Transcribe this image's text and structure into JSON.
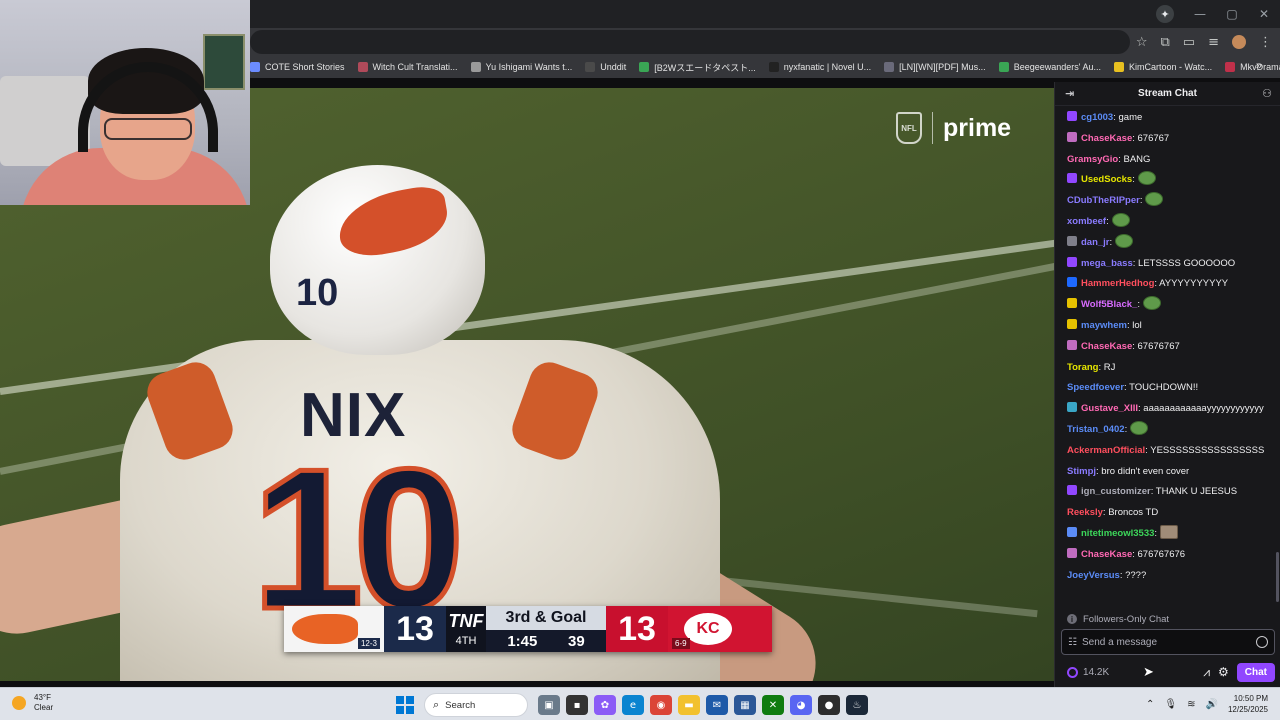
{
  "browser": {
    "bookmarks": [
      {
        "label": "COTE Short Stories",
        "color": "#6b8cff"
      },
      {
        "label": "Witch Cult Translati...",
        "color": "#b04a5a"
      },
      {
        "label": "Yu Ishigami Wants t...",
        "color": "#9a9a9a"
      },
      {
        "label": "Unddit",
        "color": "#4a4a4a"
      },
      {
        "label": "[B2Wスエードタペスト...",
        "color": "#3aa655"
      },
      {
        "label": "nyxfanatic | Novel U...",
        "color": "#222222"
      },
      {
        "label": "[LN][WN][PDF] Mus...",
        "color": "#6a6a7a"
      },
      {
        "label": "Beegeewanders' Au...",
        "color": "#3aa655"
      },
      {
        "label": "KimCartoon - Watc...",
        "color": "#e8c020"
      },
      {
        "label": "MkvDrama - Watch...",
        "color": "#c0304a"
      }
    ],
    "more_label": "»"
  },
  "video": {
    "brand_league": "NFL",
    "brand_service": "prime",
    "helmet_number": "10",
    "jersey_name": "NIX",
    "jersey_number": "10",
    "scoreboard": {
      "home_score": "13",
      "home_record": "12-3",
      "network": "TNF",
      "down_distance": "3rd & Goal",
      "quarter": "4TH",
      "game_clock": "1:45",
      "play_clock": "39",
      "away_score": "13",
      "away_record": "6-9",
      "away_logo_text": "KC"
    }
  },
  "chat": {
    "title": "Stream Chat",
    "messages": [
      {
        "user": "cg1003",
        "color": "#5b8cf7",
        "badge": "#9147ff",
        "text": ": game",
        "emote": null
      },
      {
        "user": "ChaseKase",
        "color": "#ff69b4",
        "badge": "#c06cc0",
        "text": ": 676767",
        "emote": null
      },
      {
        "user": "GramsyGio",
        "color": "#ff69b4",
        "badge": null,
        "text": ": BANG",
        "emote": null
      },
      {
        "user": "UsedSocks",
        "color": "#e6e600",
        "badge": "#9147ff",
        "text": ":",
        "emote": "pepe"
      },
      {
        "user": "CDubTheRIPper",
        "color": "#8a7bff",
        "badge": null,
        "text": ":",
        "emote": "pepe"
      },
      {
        "user": "xombeef",
        "color": "#8a7bff",
        "badge": null,
        "text": ":",
        "emote": "pepe"
      },
      {
        "user": "dan_jr",
        "color": "#8a7bff",
        "badge": "#7f7f8a",
        "text": ":",
        "emote": "pepe"
      },
      {
        "user": "mega_bass",
        "color": "#8a7bff",
        "badge": "#9147ff",
        "text": ": LETSSSS GOOOOOO",
        "emote": null
      },
      {
        "user": "HammerHedhog",
        "color": "#ff4f5e",
        "badge": "#1e69ff",
        "text": ": AYYYYYYYYYY",
        "emote": null
      },
      {
        "user": "Wolf5Black_",
        "color": "#d86bff",
        "badge": "#e6c200",
        "text": ":",
        "emote": "pepe"
      },
      {
        "user": "maywhem",
        "color": "#5b8cf7",
        "badge": "#e6c200",
        "text": ": lol",
        "emote": null
      },
      {
        "user": "ChaseKase",
        "color": "#ff69b4",
        "badge": "#c06cc0",
        "text": ": 67676767",
        "emote": null
      },
      {
        "user": "Torang",
        "color": "#e6e600",
        "badge": null,
        "text": ": RJ",
        "emote": null
      },
      {
        "user": "Speedfoever",
        "color": "#5b8cf7",
        "badge": null,
        "text": ": TOUCHDOWN!!",
        "emote": null
      },
      {
        "user": "Gustave_XIII",
        "color": "#ff69b4",
        "badge": "#3aa6c6",
        "text": ": aaaaaaaaaaaayyyyyyyyyyyy",
        "emote": null,
        "wrap": true
      },
      {
        "user": "Tristan_0402",
        "color": "#5b8cf7",
        "badge": null,
        "text": ":",
        "emote": "pepe"
      },
      {
        "user": "AckermanOfficial",
        "color": "#ff4f5e",
        "badge": null,
        "text": ": YESSSSSSSSSSSSSSSS",
        "emote": null
      },
      {
        "user": "Stimpj",
        "color": "#8a7bff",
        "badge": null,
        "text": ": bro didn't even cover",
        "emote": null
      },
      {
        "user": "ign_customizer",
        "color": "#adadb8",
        "badge": "#9147ff",
        "text": ": THANK U JEESUS",
        "emote": null
      },
      {
        "user": "Reeksly",
        "color": "#ff4f5e",
        "badge": null,
        "text": ": Broncos TD",
        "emote": null
      },
      {
        "user": "nitetimeowl3533",
        "color": "#3cd65a",
        "badge": "#5b8cf7",
        "text": ":",
        "emote": "photo"
      },
      {
        "user": "ChaseKase",
        "color": "#ff69b4",
        "badge": "#c06cc0",
        "text": ": 676767676",
        "emote": null
      },
      {
        "user": "JoeyVersus",
        "color": "#5b8cf7",
        "badge": null,
        "text": ": ????",
        "emote": null
      }
    ],
    "followers_only": "Followers-Only Chat",
    "input_placeholder": "Send a message",
    "points": "14.2K",
    "chat_button": "Chat"
  },
  "taskbar": {
    "weather_temp": "43°F",
    "weather_desc": "Clear",
    "search_label": "Search",
    "time": "10:50 PM",
    "date": "12/25/2025"
  }
}
